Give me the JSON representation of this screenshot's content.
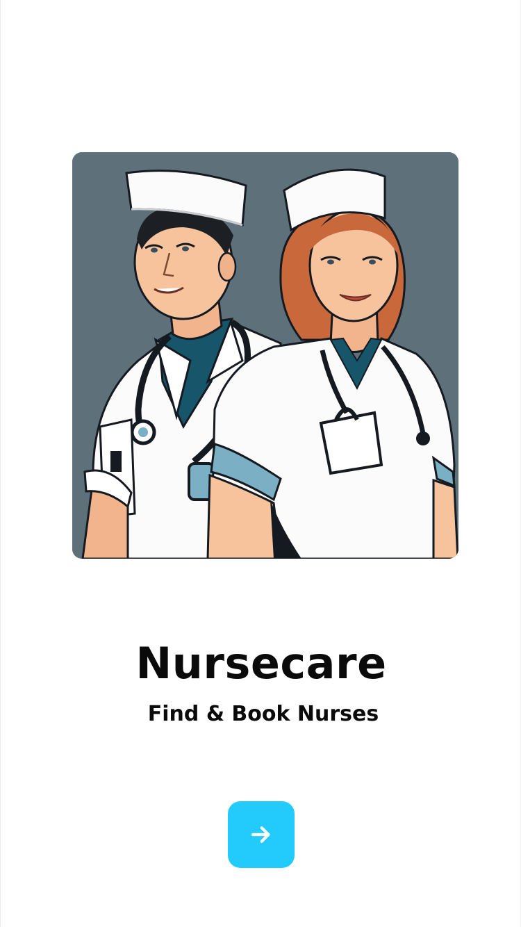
{
  "app": {
    "title": "Nursecare",
    "tagline": "Find & Book Nurses"
  },
  "hero": {
    "illustration": "two-nurses-illustration",
    "background_color": "#5e717b"
  },
  "next_button": {
    "icon": "arrow-right-icon",
    "color": "#22cbfb"
  }
}
